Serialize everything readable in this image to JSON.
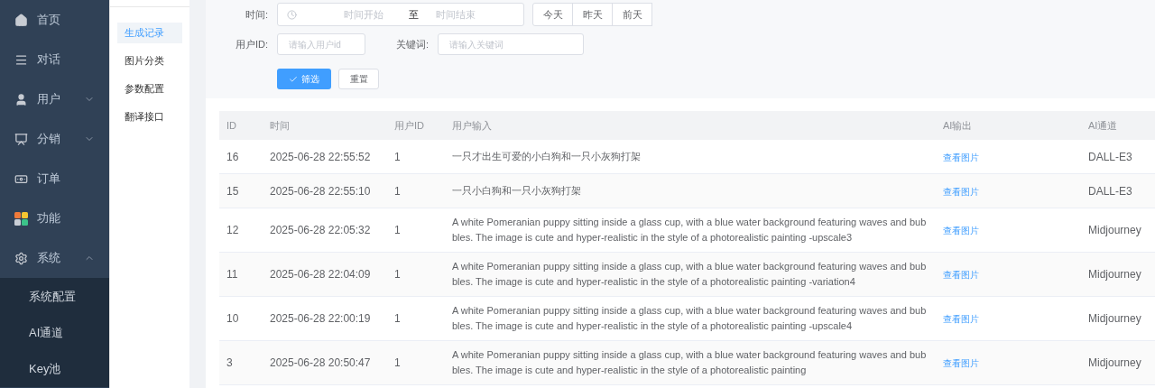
{
  "sidebar": {
    "items": [
      {
        "label": "首页"
      },
      {
        "label": "对话"
      },
      {
        "label": "用户",
        "expanded": false
      },
      {
        "label": "分销",
        "expanded": false
      },
      {
        "label": "订单"
      },
      {
        "label": "功能"
      },
      {
        "label": "系统",
        "expanded": true,
        "children": [
          {
            "label": "系统配置"
          },
          {
            "label": "AI通道"
          },
          {
            "label": "Key池"
          }
        ]
      }
    ]
  },
  "sub_menu": {
    "items": [
      {
        "label": "生成记录",
        "selected": true
      },
      {
        "label": "图片分类",
        "selected": false
      },
      {
        "label": "参数配置",
        "selected": false
      },
      {
        "label": "翻译接口",
        "selected": false
      }
    ]
  },
  "filters": {
    "time": {
      "label": "时间:",
      "start_placeholder": "时间开始",
      "separator": "至",
      "end_placeholder": "时间结束"
    },
    "quick_dates": [
      "今天",
      "昨天",
      "前天"
    ],
    "user_id": {
      "label": "用户ID:",
      "placeholder": "请输入用户id"
    },
    "keyword": {
      "label": "关键词:",
      "placeholder": "请输入关键词"
    },
    "submit": "筛选",
    "reset": "重置"
  },
  "table": {
    "columns": [
      "ID",
      "时间",
      "用户ID",
      "用户输入",
      "AI输出",
      "AI通道"
    ],
    "rows": [
      {
        "id": "16",
        "time": "2025-06-28 22:55:52",
        "user_id": "1",
        "input": "一只才出生可爱的小白狗和一只小灰狗打架",
        "output": "查看图片",
        "channel": "DALL-E3"
      },
      {
        "id": "15",
        "time": "2025-06-28 22:55:10",
        "user_id": "1",
        "input": "一只小白狗和一只小灰狗打架",
        "output": "查看图片",
        "channel": "DALL-E3"
      },
      {
        "id": "12",
        "time": "2025-06-28 22:05:32",
        "user_id": "1",
        "input": "A white Pomeranian puppy sitting inside a glass cup, with a blue water background featuring waves and bubbles. The image is cute and hyper-realistic in the style of a photorealistic painting  -upscale3",
        "output": "查看图片",
        "channel": "Midjourney"
      },
      {
        "id": "11",
        "time": "2025-06-28 22:04:09",
        "user_id": "1",
        "input": "A white Pomeranian puppy sitting inside a glass cup, with a blue water background featuring waves and bubbles. The image is cute and hyper-realistic in the style of a photorealistic painting -variation4",
        "output": "查看图片",
        "channel": "Midjourney"
      },
      {
        "id": "10",
        "time": "2025-06-28 22:00:19",
        "user_id": "1",
        "input": "A white Pomeranian puppy sitting inside a glass cup, with a blue water background featuring waves and bubbles. The image is cute and hyper-realistic in the style of a photorealistic painting -upscale4",
        "output": "查看图片",
        "channel": "Midjourney"
      },
      {
        "id": "3",
        "time": "2025-06-28 20:50:47",
        "user_id": "1",
        "input": "A white Pomeranian puppy sitting inside a glass cup, with a blue water background featuring waves and bubbles. The image is cute and hyper-realistic in the style of a photorealistic painting",
        "output": "查看图片",
        "channel": "Midjourney"
      }
    ]
  }
}
